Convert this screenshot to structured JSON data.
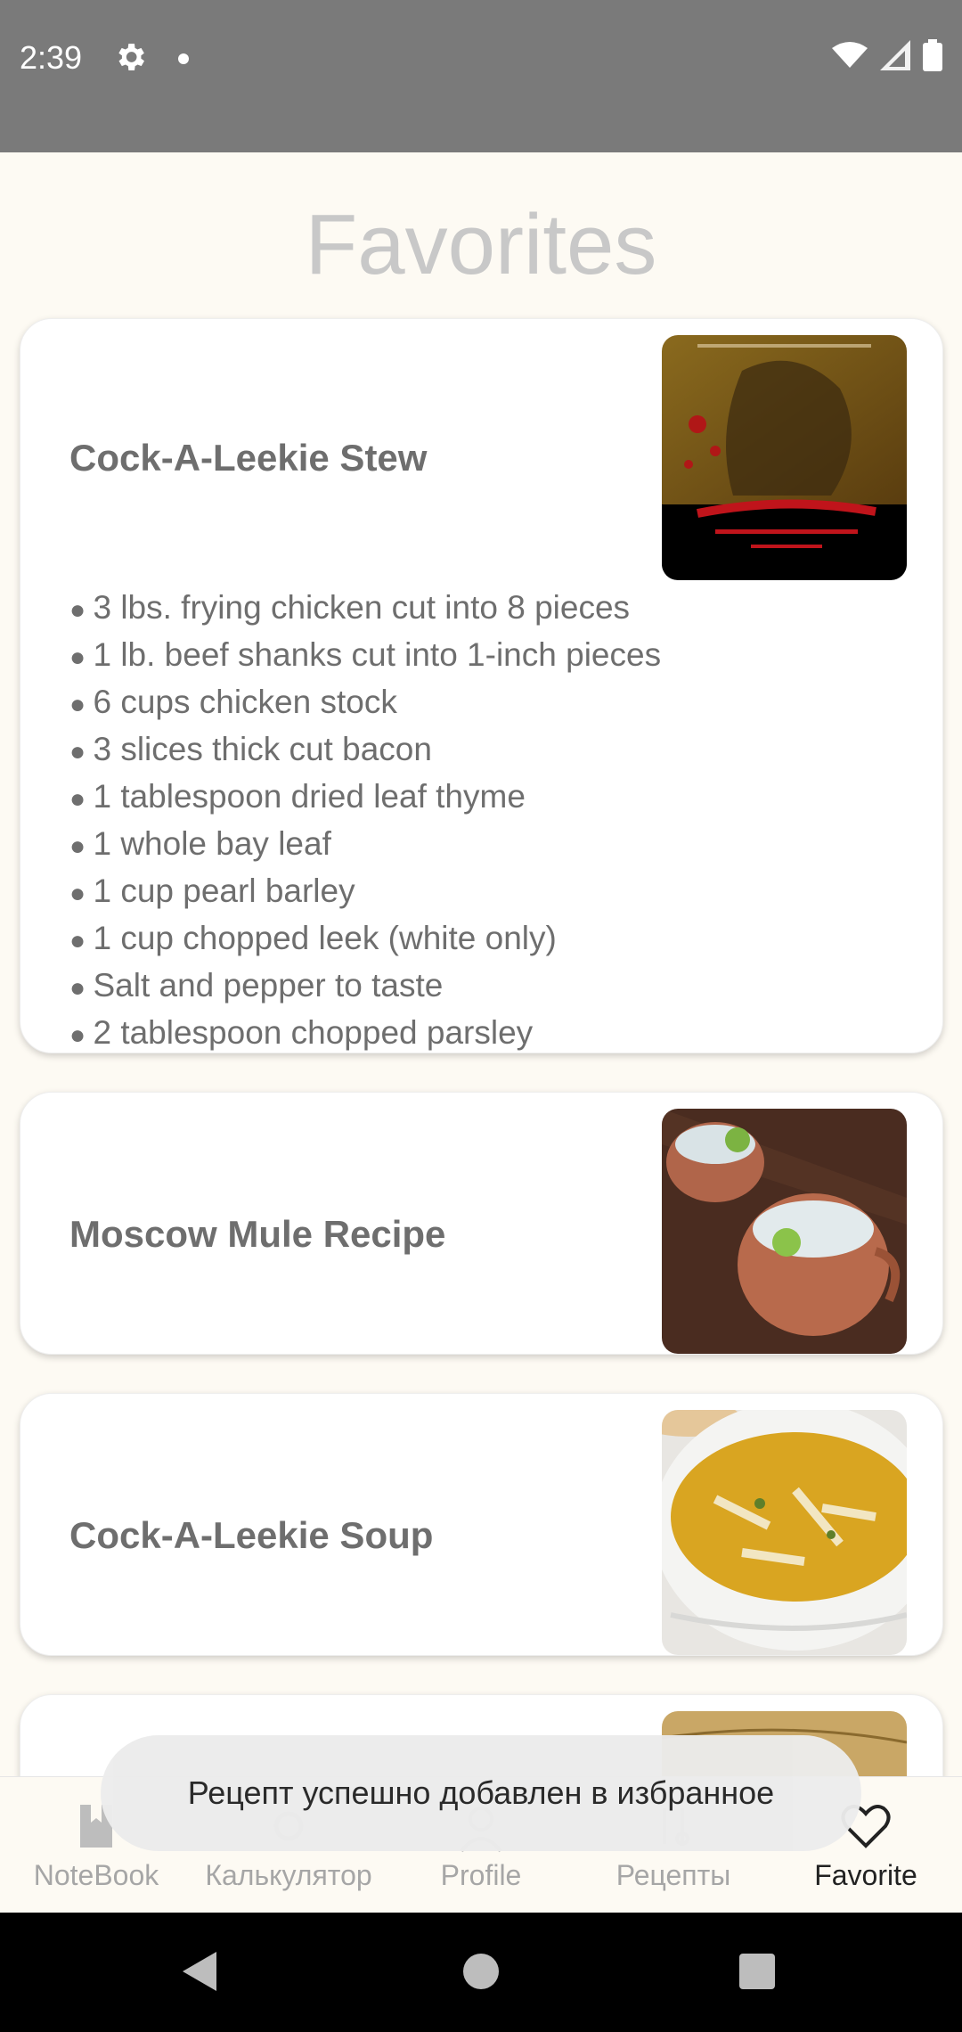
{
  "status_bar": {
    "time": "2:39"
  },
  "page": {
    "title": "Favorites"
  },
  "favorites": [
    {
      "title": "Cock-A-Leekie Stew",
      "image": "sweeney-todd-poster",
      "ingredients": [
        "3 lbs. frying chicken cut into 8 pieces",
        "1 lb. beef shanks cut into 1-inch pieces",
        "6 cups chicken stock",
        "3 slices thick cut bacon",
        "1 tablespoon dried leaf thyme",
        "1 whole bay leaf",
        "1 cup pearl barley",
        "1 cup chopped leek (white only)",
        "Salt and pepper to taste",
        "2 tablespoon chopped parsley"
      ]
    },
    {
      "title": "Moscow Mule Recipe",
      "image": "copper-mugs-photo"
    },
    {
      "title": "Cock-A-Leekie Soup",
      "image": "soup-bowl-photo"
    },
    {
      "title": "",
      "image": "parchment-photo"
    }
  ],
  "bottom_nav": {
    "items": [
      {
        "label": "NoteBook",
        "icon": "notebook-icon",
        "active": false
      },
      {
        "label": "Калькулятор",
        "icon": "calculator-icon",
        "active": false
      },
      {
        "label": "Profile",
        "icon": "profile-icon",
        "active": false
      },
      {
        "label": "Рецепты",
        "icon": "recipes-icon",
        "active": false
      },
      {
        "label": "Favorite",
        "icon": "heart-icon",
        "active": true
      }
    ]
  },
  "toast": {
    "message": "Рецепт успешно добавлен в избранное"
  },
  "colors": {
    "background": "#fdfaf3",
    "status_bar": "#7a7a7a",
    "title": "#c8c8c8",
    "card_text": "#6e6e6e",
    "nav_inactive": "#a6a6a6",
    "nav_active": "#222222"
  }
}
